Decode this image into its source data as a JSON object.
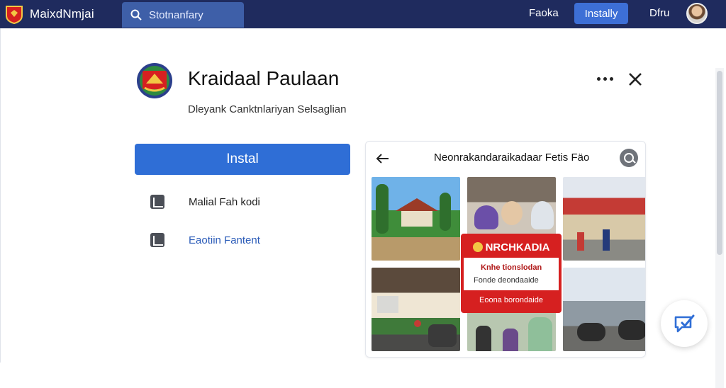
{
  "topbar": {
    "brand_name": "MaixdNmjai",
    "search_placeholder": "Stotnanfary",
    "nav_link_1": "Faoka",
    "nav_install": "Instally",
    "nav_link_2": "Dfru"
  },
  "app": {
    "title": "Kraidaal Paulaan",
    "subtitle": "Dleyank Canktnlariyan Selsaglian",
    "install_label": "Instal",
    "actions": [
      {
        "label": "Malial Fah kodi",
        "icon": "launch-icon",
        "color": "#222222"
      },
      {
        "label": "Eaotiin Fantent",
        "icon": "report-icon",
        "color": "#2a5bb8"
      }
    ]
  },
  "preview": {
    "title": "Neonrakandaraikadaar Fetis Fäo",
    "banner_title": "NRCHKADIA",
    "banner_line1": "Knhe tionslodan",
    "banner_line2": "Fonde deondaaide",
    "banner_footer": "Eoona borondaide"
  },
  "colors": {
    "topbar_bg": "#1f2b5e",
    "accent": "#2f6ed6",
    "banner_red": "#d62020"
  }
}
